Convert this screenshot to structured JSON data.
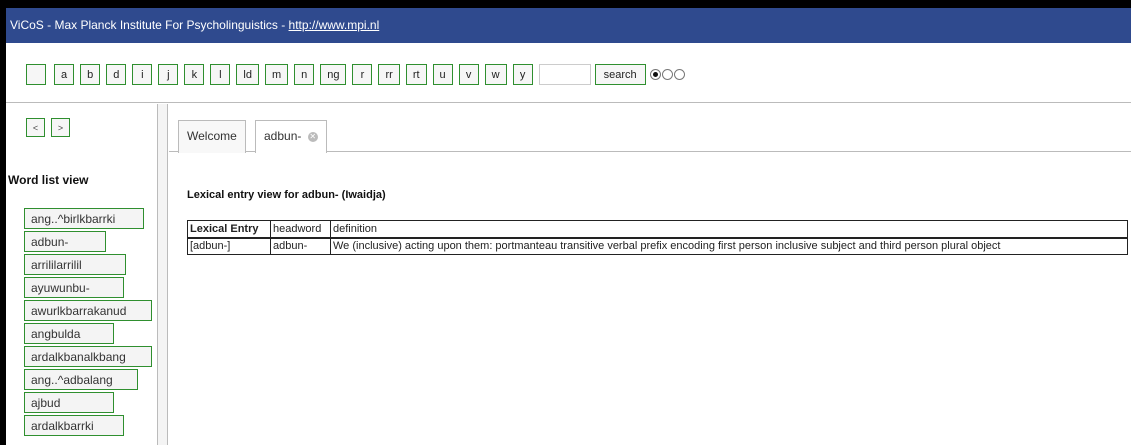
{
  "window": {
    "title_prefix": "ViCoS - Max Planck Institute For Psycholinguistics - ",
    "title_link": "http://www.mpi.nl"
  },
  "toolbar": {
    "letters": [
      "a",
      "b",
      "d",
      "i",
      "j",
      "k",
      "l",
      "ld",
      "m",
      "n",
      "ng",
      "r",
      "rr",
      "rt",
      "u",
      "v",
      "w",
      "y"
    ],
    "search_value": "",
    "search_label": "search",
    "radio_selected": 0
  },
  "sidebar": {
    "prev_label": "<",
    "next_label": ">",
    "title": "Word list view",
    "words": [
      "ang..^birlkbarrki",
      "adbun-",
      "arrililarrilil",
      "ayuwunbu-",
      "awurlkbarrakanud",
      "angbulda",
      "ardalkbanalkbang",
      "ang..^adbalang",
      "ajbud",
      "ardalkbarrki"
    ]
  },
  "tabs": [
    {
      "label": "Welcome"
    },
    {
      "label": "adbun-"
    }
  ],
  "entry": {
    "title": "Lexical entry view for adbun- (Iwaidja)",
    "columns": [
      "Lexical Entry",
      "headword",
      "definition"
    ],
    "row": [
      "[adbun-]",
      "adbun-",
      "We (inclusive) acting upon them: portmanteau transitive verbal prefix encoding first person inclusive subject and third person plural object"
    ]
  },
  "colors": {
    "titlebar": "#2f4a8e",
    "button_border": "#2f8f2f"
  }
}
